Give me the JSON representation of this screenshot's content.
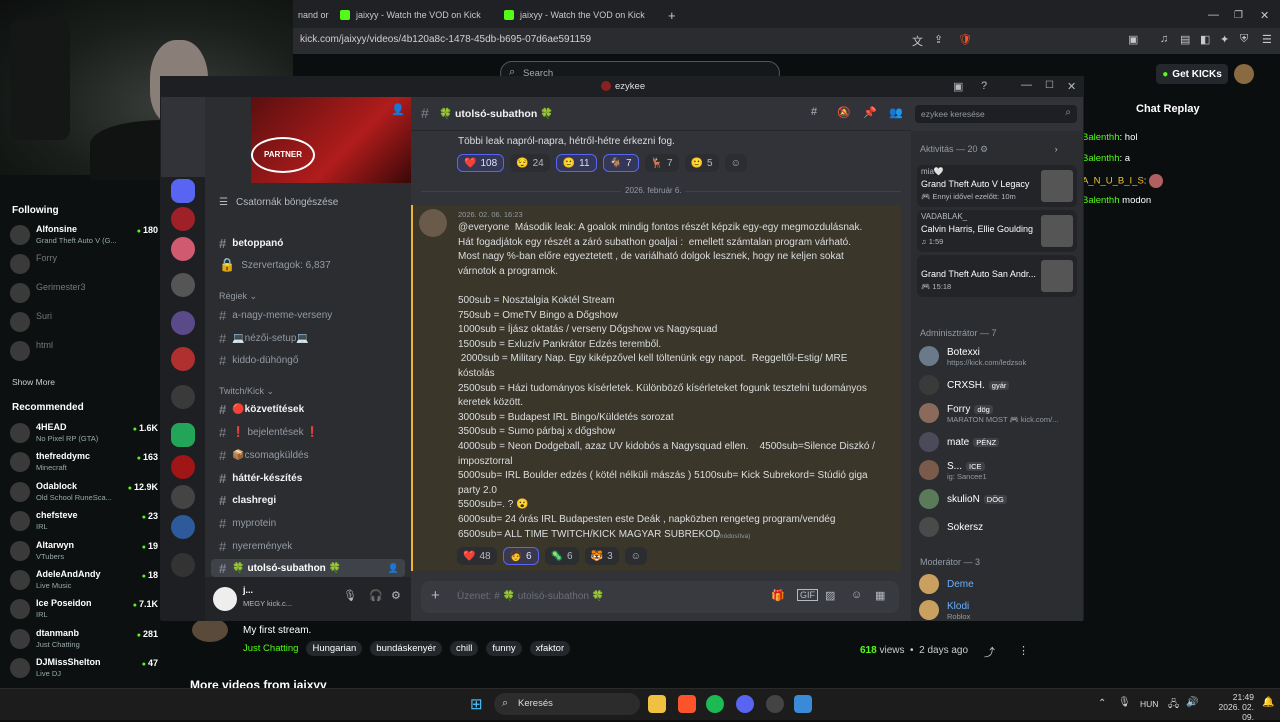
{
  "browser": {
    "tabs": [
      "nand or",
      "jaixyy - Watch the VOD on Kick",
      "jaixyy - Watch the VOD on Kick"
    ],
    "url": "kick.com/jaixyy/videos/4b120a8c-1478-45db-b695-07d6ae591159"
  },
  "kick": {
    "search_placeholder": "Search",
    "get_kicks": "Get KICKs",
    "following_header": "Following",
    "following": [
      {
        "name": "Alfonsine",
        "cat": "Grand Theft Auto V (G...",
        "viewers": "180",
        "live": true
      },
      {
        "name": "Forry",
        "cat": "",
        "viewers": "",
        "live": false
      },
      {
        "name": "Gerimester3",
        "cat": "",
        "viewers": "",
        "live": false
      },
      {
        "name": "Suri",
        "cat": "",
        "viewers": "",
        "live": false
      },
      {
        "name": "html",
        "cat": "",
        "viewers": "",
        "live": false
      }
    ],
    "show_more": "Show More",
    "recommended_header": "Recommended",
    "recommended": [
      {
        "name": "4HEAD",
        "cat": "No Pixel RP (GTA)",
        "viewers": "1.6K"
      },
      {
        "name": "thefreddymc",
        "cat": "Minecraft",
        "viewers": "163"
      },
      {
        "name": "Odablock",
        "cat": "Old School RuneSca...",
        "viewers": "12.9K"
      },
      {
        "name": "chefsteve",
        "cat": "IRL",
        "viewers": "23"
      },
      {
        "name": "Altarwyn",
        "cat": "VTubers",
        "viewers": "19"
      },
      {
        "name": "AdeleAndAndy",
        "cat": "Live Music",
        "viewers": "18"
      },
      {
        "name": "Ice Poseidon",
        "cat": "IRL",
        "viewers": "7.1K"
      },
      {
        "name": "dtanmanb",
        "cat": "Just Chatting",
        "viewers": "281"
      },
      {
        "name": "DJMissShelton",
        "cat": "Live DJ",
        "viewers": "47"
      }
    ],
    "chat_replay_title": "Chat Replay",
    "chat": [
      {
        "user": "Balenthh",
        "text": "hol"
      },
      {
        "user": "Balenthh",
        "text": "a"
      },
      {
        "user": "A_N_U_B_I_S",
        "text": ""
      },
      {
        "user": "Balenthh",
        "text": "modon"
      }
    ],
    "stream_title": "My first stream.",
    "category": "Just Chatting",
    "tags": [
      "Hungarian",
      "bundáskenyér",
      "chill",
      "funny",
      "xfaktor"
    ],
    "views": "618",
    "views_label": "views",
    "age": "2 days ago",
    "more_videos": "More videos from jaixyy"
  },
  "discord": {
    "window_title": "ezykee",
    "browse_channels": "Csatornák böngészése",
    "partner": "PARTNER",
    "channels_top": [
      {
        "name": "betoppanó",
        "unread": true
      },
      {
        "name": "Szervertagok: 6,837",
        "unread": false,
        "lock": true
      }
    ],
    "cat1": "Régiek",
    "channels_cat1": [
      {
        "name": "a-nagy-meme-verseny"
      },
      {
        "name": "💻nézői-setup💻"
      },
      {
        "name": "kiddo-dühöngő"
      }
    ],
    "cat2": "Twitch/Kick",
    "channels_cat2": [
      {
        "name": "🔴közvetítések",
        "unread": true
      },
      {
        "name": "❗ bejelentések ❗",
        "unread": false
      },
      {
        "name": "📦csomagküldés",
        "unread": false
      },
      {
        "name": "háttér-készítés",
        "unread": true
      },
      {
        "name": "clashregi",
        "unread": true
      },
      {
        "name": "myprotein",
        "unread": false
      },
      {
        "name": "nyeremények",
        "unread": false
      },
      {
        "name": "🍀 utolsó-subathon 🍀",
        "unread": true
      }
    ],
    "channel_header": "🍀 utolsó-subathon 🍀",
    "member_search_placeholder": "ezykee keresése",
    "prev_message": "Többi leak napról-napra, hétről-hétre érkezni fog.",
    "prev_reactions": [
      {
        "emoji": "❤️",
        "count": "108",
        "me": true
      },
      {
        "emoji": "😌",
        "count": "24"
      },
      {
        "emoji": "🙂",
        "count": "11",
        "me": true
      },
      {
        "emoji": "🐐",
        "count": "7",
        "me": true
      },
      {
        "emoji": "🦌",
        "count": "7"
      },
      {
        "emoji": "🙂",
        "count": "5"
      }
    ],
    "date_divider": "2026. február 6.",
    "msg_time": "2026. 02. 06. 16:23",
    "msg_lines": [
      "@everyone  Második leak: A goalok mindig fontos részét képzik egy-egy megmozdulásnak.",
      "Hát fogadjátok egy részét a záró subathon goaljai :  emellett számtalan program várható.",
      "Most nagy %-ban előre egyeztetett , de variálható dolgok lesznek, hogy ne keljen sokat",
      "várnotok a programok.",
      "",
      "500sub = Nosztalgia Koktél Stream",
      "750sub = OmeTV Bingo a Dőgshow",
      "1000sub = Íjász oktatás / verseny Dőgshow vs Nagysquad",
      "1500sub = Exluzív Pankrátor Edzés teremből.",
      " 2000sub = Military Nap. Egy kiképzővel kell töltenünk egy napot.  Reggeltől-Estig/ MRE",
      "kóstolás",
      "2500sub = Házi tudományos kísérletek. Különböző kísérleteket fogunk tesztelni tudományos",
      "keretek között.",
      "3000sub = Budapest IRL Bingo/Küldetés sorozat",
      "3500sub = Sumo párbaj x dőgshow",
      "4000sub = Neon Dodgeball, azaz UV kidobós a Nagysquad ellen.    4500sub=Silence Diszkó /",
      "imposztorral",
      "5000sub= IRL Boulder edzés ( kötél nélküli mászás ) 5100sub= Kick Subrekord= Stúdió giga",
      "party 2.0",
      "5500sub=. ? 😮",
      "6000sub= 24 órás IRL Budapesten este Deák , napközben rengeteg program/vendég",
      "6500sub= ALL TIME TWITCH/KICK MAGYAR SUBREKOD"
    ],
    "edited": "(módosítva)",
    "msg_reactions": [
      {
        "emoji": "❤️",
        "count": "48"
      },
      {
        "emoji": "🧑",
        "count": "6",
        "me": true
      },
      {
        "emoji": "🦠",
        "count": "6"
      },
      {
        "emoji": "🐯",
        "count": "3"
      }
    ],
    "input_placeholder": "Üzenet: # 🍀 utolsó-subathon 🍀",
    "activity_header": "Aktivitás — 20",
    "activities": [
      {
        "name": "mia🤍",
        "title": "Grand Theft Auto V Legacy",
        "sub": "🎮 Ennyi idővel ezelőtt: 10m"
      },
      {
        "name": "VADABLAK_",
        "title": "Calvin Harris, Ellie Goulding",
        "sub": "♫ 1:59"
      },
      {
        "name": "",
        "title": "Grand Theft Auto San Andr...",
        "sub": "🎮 15:18"
      }
    ],
    "admin_header": "Adminisztrátor — 7",
    "admins": [
      {
        "name": "Botexxi",
        "sub": "https://kick.com/ledzsok",
        "tag": ""
      },
      {
        "name": "CRXSH.",
        "sub": "",
        "tag": "gyár"
      },
      {
        "name": "Forry",
        "sub": "MARATON MOST 🎮 kick.com/...",
        "tag": "dög"
      },
      {
        "name": "mate",
        "sub": "",
        "tag": "PÉNZ"
      },
      {
        "name": "S...",
        "sub": "ig: Sancee1",
        "tag": "ICE"
      },
      {
        "name": "skulioN",
        "sub": "",
        "tag": "DÖG"
      },
      {
        "name": "Sokersz",
        "sub": "",
        "tag": ""
      }
    ],
    "mod_header": "Moderátor — 3",
    "mods": [
      {
        "name": "Deme",
        "sub": ""
      },
      {
        "name": "Klodi",
        "sub": "Roblox"
      }
    ],
    "user": {
      "name": "j...",
      "status": "MEGY  kick.c..."
    }
  },
  "taskbar": {
    "search": "Keresés",
    "lang": "HUN",
    "time": "21:49",
    "date": "2026. 02. 09."
  },
  "colors": {
    "kick_green": "#53fc18",
    "discord_bg": "#313338",
    "highlight": "#f0b232"
  }
}
